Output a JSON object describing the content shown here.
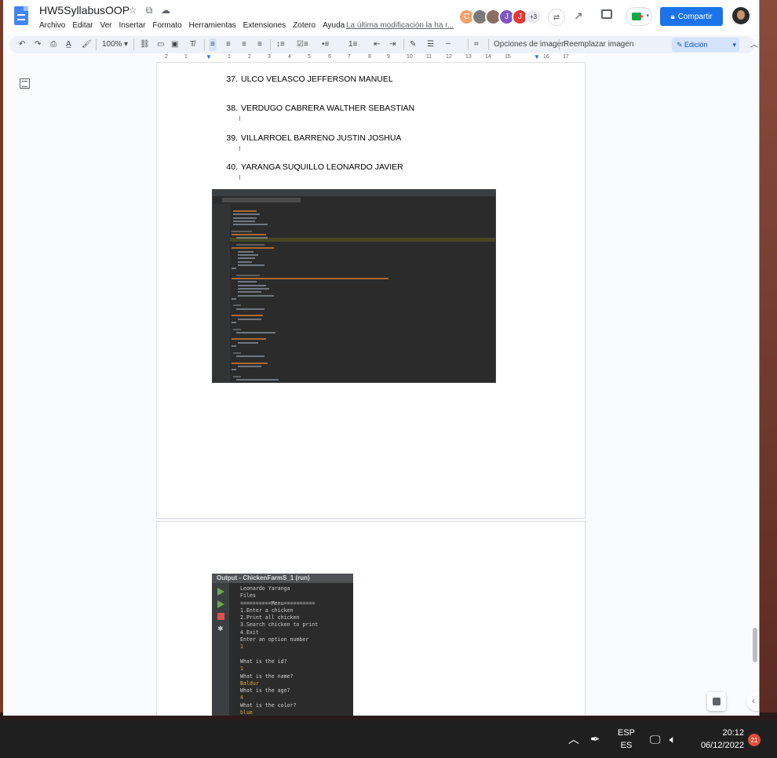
{
  "doc": {
    "title": "HW5SyllabusOOP",
    "menu": [
      "Archivo",
      "Editar",
      "Ver",
      "Insertar",
      "Formato",
      "Herramientas",
      "Extensiones",
      "Zotero",
      "Ayuda"
    ],
    "last_edit": "La última modificación la ha r..."
  },
  "collaborators": {
    "avatars": [
      {
        "initial": "C",
        "color": "#f6a06b"
      },
      {
        "initial": "",
        "color": "#7b7b7b"
      },
      {
        "initial": "",
        "color": "#8d6e63"
      },
      {
        "initial": "J",
        "color": "#7e57c2"
      },
      {
        "initial": "J",
        "color": "#e53935"
      }
    ],
    "more": "+3"
  },
  "header": {
    "share_label": "Compartir"
  },
  "toolbar": {
    "zoom": "100%",
    "image_options": "Opciones de imagen",
    "replace_image": "Reemplazar imagen",
    "mode": "Edición"
  },
  "ruler": [
    "2",
    "1",
    "1",
    "2",
    "3",
    "4",
    "5",
    "6",
    "7",
    "8",
    "9",
    "10",
    "11",
    "12",
    "13",
    "14",
    "15",
    "16",
    "17",
    "18"
  ],
  "students": [
    {
      "num": "37.",
      "name": "ULCO VELASCO JEFFERSON MANUEL"
    },
    {
      "num": "38.",
      "name": "VERDUGO CABRERA WALTHER SEBASTIAN"
    },
    {
      "num": "39.",
      "name": "VILLARROEL BARRENO JUSTIN JOSHUA"
    },
    {
      "num": "40.",
      "name": "YARANGA SUQUILLO LEONARDO JAVIER"
    }
  ],
  "output_console": {
    "title": "Output - ChickenFarmS_1 (run)",
    "lines": [
      {
        "text": "Leonardo Yaranga",
        "input": false
      },
      {
        "text": "Files",
        "input": false
      },
      {
        "text": "==========Menu==========",
        "input": false
      },
      {
        "text": "1.Enter a chicken",
        "input": false
      },
      {
        "text": "2.Print all chicken",
        "input": false
      },
      {
        "text": "3.Search chicken to print",
        "input": false
      },
      {
        "text": "4.Exit",
        "input": false
      },
      {
        "text": "Enter an option number",
        "input": false
      },
      {
        "text": "1",
        "input": true
      },
      {
        "text": "",
        "input": false
      },
      {
        "text": "What is the id?",
        "input": false
      },
      {
        "text": "1",
        "input": true
      },
      {
        "text": "What is the name?",
        "input": false
      },
      {
        "text": "Baldur",
        "input": true
      },
      {
        "text": "What is the age?",
        "input": false
      },
      {
        "text": "4",
        "input": true
      },
      {
        "text": "What is the color?",
        "input": false
      },
      {
        "text": "blue",
        "input": true
      }
    ]
  },
  "taskbar": {
    "lang_top": "ESP",
    "lang_bottom": "ES",
    "time": "20:12",
    "date": "06/12/2022",
    "notifications": "21"
  },
  "colors": {
    "share_blue": "#1a73e8",
    "console_bg": "#2b2b2b",
    "console_input": "#e6a33e"
  }
}
